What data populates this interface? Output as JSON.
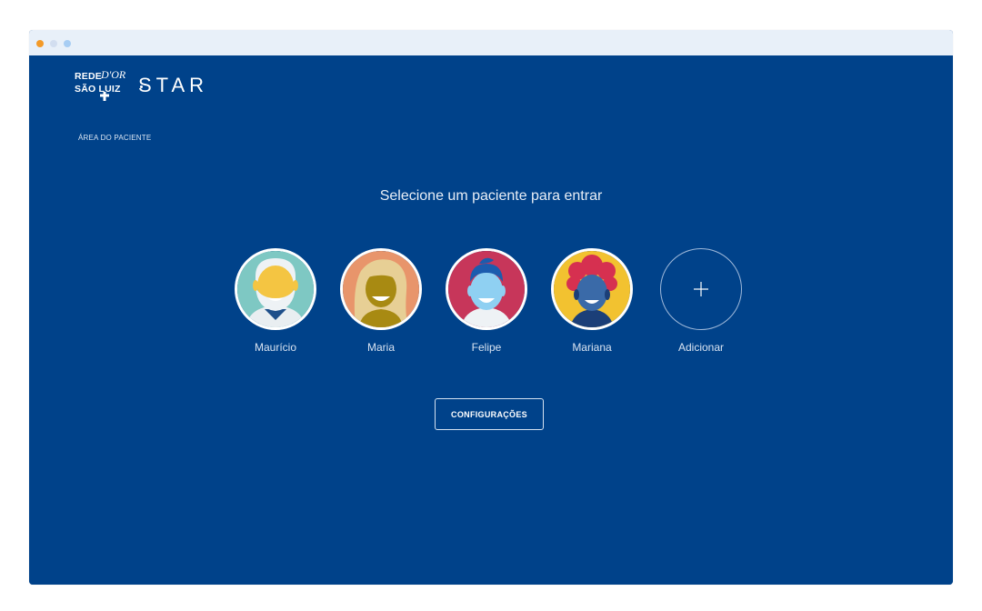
{
  "window": {
    "controls": [
      "close",
      "minimize",
      "maximize"
    ]
  },
  "logo": {
    "rede": "REDE",
    "dor": "D'OR",
    "sao_luiz": "SÃO LUIZ",
    "star": "STAR"
  },
  "page": {
    "area_label": "ÁREA DO PACIENTE",
    "heading": "Selecione um paciente para entrar"
  },
  "patients": [
    {
      "name": "Maurício",
      "avatar_bg": "#7ec8c3",
      "skin": "#f4c542"
    },
    {
      "name": "Maria",
      "avatar_bg": "#e8956b",
      "skin": "#a88a12"
    },
    {
      "name": "Felipe",
      "avatar_bg": "#c7365a",
      "skin": "#8fd0f2"
    },
    {
      "name": "Mariana",
      "avatar_bg": "#f2c230",
      "skin": "#3a6aa8"
    }
  ],
  "add": {
    "label": "Adicionar",
    "icon": "plus-icon"
  },
  "actions": {
    "config_label": "CONFIGURAÇÕES"
  },
  "colors": {
    "background": "#00428a",
    "titlebar": "#e8f0f9"
  }
}
